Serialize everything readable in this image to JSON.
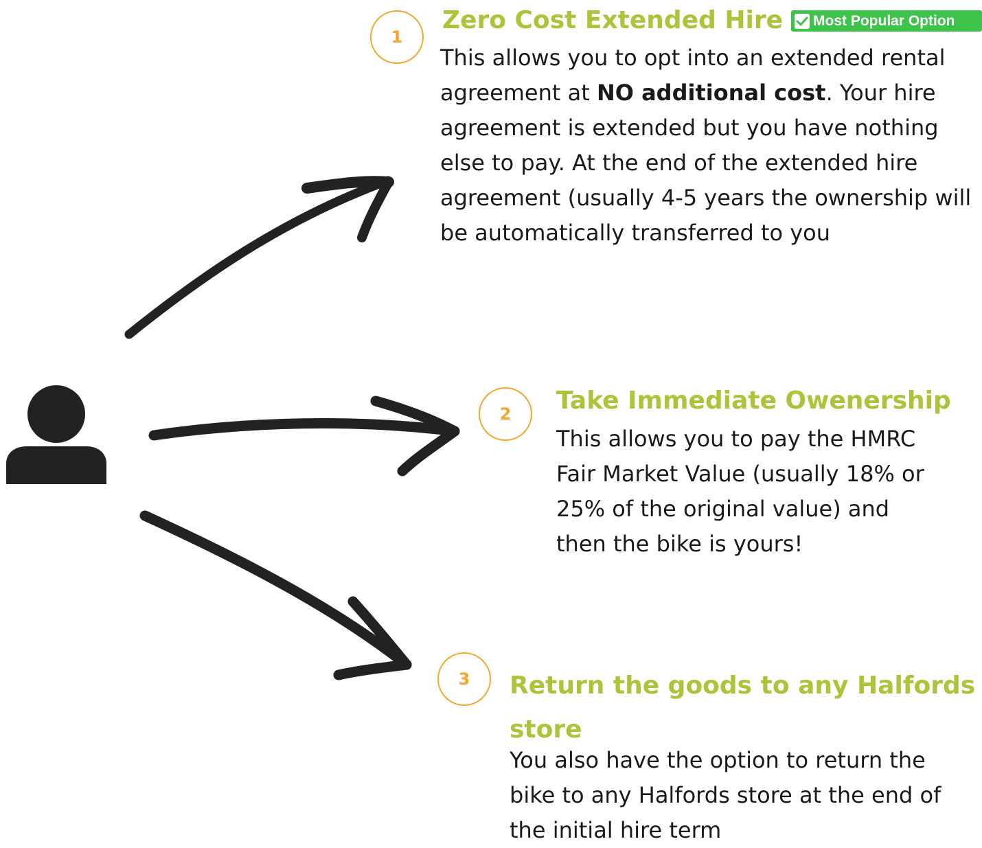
{
  "colors": {
    "title": "#adc43a",
    "step_number": "#f4a52b",
    "badge_background": "#3dc24a",
    "arrow": "#222222",
    "person_icon": "#222222",
    "body_text": "#1a1a1a"
  },
  "person": {
    "icon": "person-icon"
  },
  "options": [
    {
      "number": "1",
      "title": "Zero Cost Extended Hire",
      "badge": {
        "icon": "check-icon",
        "label": "Most Popular Option"
      },
      "body": {
        "before": "This allows you to opt into an extended rental agreement at ",
        "emphasis": "NO additional cost",
        "after": ". Your hire agreement is extended but you have nothing else to pay. At the end of the extended hire agreement (usually 4-5 years the ownership will be automatically transferred to you"
      }
    },
    {
      "number": "2",
      "title": "Take Immediate Owenership",
      "body": "This allows you to pay the HMRC Fair Market Value (usually 18% or 25% of the original value) and then the bike is yours!"
    },
    {
      "number": "3",
      "title": "Return the goods to any Halfords store",
      "body": "You also have the option to return the bike to any Halfords store at the end of the initial hire term"
    }
  ]
}
